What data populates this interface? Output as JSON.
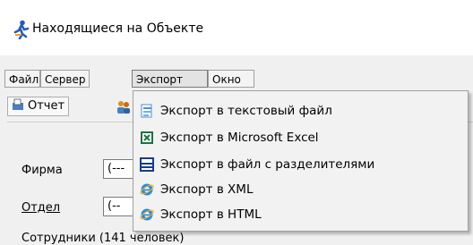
{
  "window": {
    "title": "Находящиеся на Объекте",
    "icon": "running-man-icon"
  },
  "menubar": {
    "items": [
      {
        "label": "Файл"
      },
      {
        "label": "Сервер"
      },
      {
        "label": "Экспорт"
      },
      {
        "label": "Окно"
      }
    ]
  },
  "toolbar": {
    "report_label": "Отчет",
    "report_icon": "report-icon",
    "people_icon": "people-icon"
  },
  "form": {
    "firm_label": "Фирма",
    "firm_value": "(---",
    "dept_label": "Отдел",
    "dept_value": "(--",
    "employees_label": "Сотрудники (141 человек)"
  },
  "export_menu": {
    "items": [
      {
        "label": "Экспорт в текстовый файл",
        "icon": "text-file-icon"
      },
      {
        "label": "Экспорт в Microsoft Excel",
        "icon": "excel-icon"
      },
      {
        "label": "Экспорт в файл с разделителями",
        "icon": "delimited-file-icon"
      },
      {
        "label": "Экспорт в XML",
        "icon": "ie-icon"
      },
      {
        "label": "Экспорт в HTML",
        "icon": "ie-icon"
      }
    ]
  },
  "colors": {
    "accent": "#0078d7",
    "excel": "#1e7145",
    "highlight": "#cde8ff"
  }
}
